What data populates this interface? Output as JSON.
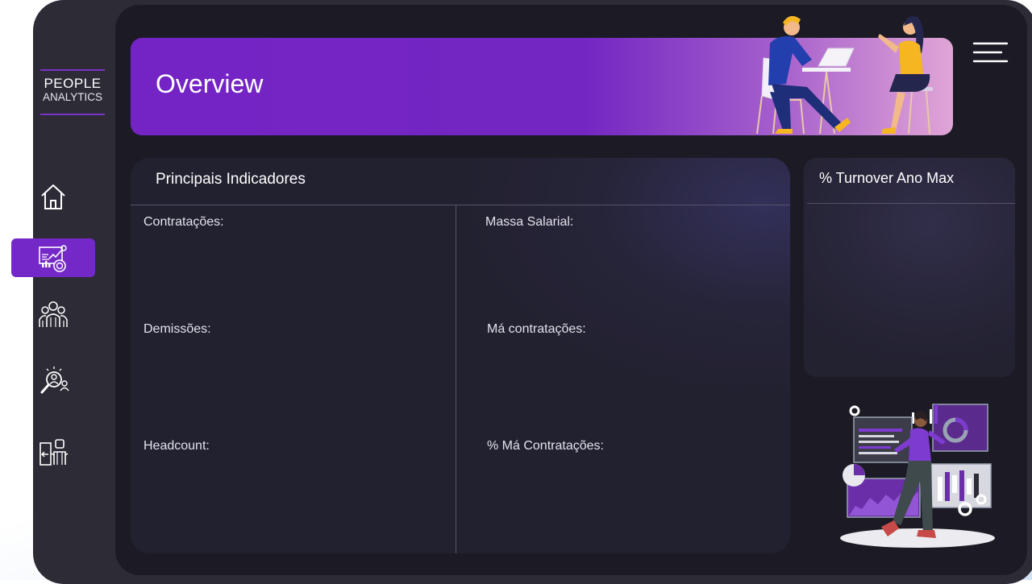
{
  "brand": {
    "line1": "PEOPLE",
    "line2": "ANALYTICS"
  },
  "sidebar": {
    "items": [
      {
        "icon": "home-icon",
        "active": false
      },
      {
        "icon": "analytics-dashboard-icon",
        "active": true
      },
      {
        "icon": "team-icon",
        "active": false
      },
      {
        "icon": "talent-search-icon",
        "active": false
      },
      {
        "icon": "employee-exit-icon",
        "active": false
      }
    ]
  },
  "header": {
    "title": "Overview",
    "menu_icon": "hamburger-menu-icon"
  },
  "indicators": {
    "title": "Principais Indicadores",
    "left": [
      {
        "label": "Contratações:"
      },
      {
        "label": "Demissões:"
      },
      {
        "label": "Headcount:"
      }
    ],
    "right": [
      {
        "label": "Massa Salarial:"
      },
      {
        "label": "Má contratações:"
      },
      {
        "label": "% Má Contratações:"
      }
    ]
  },
  "turnover": {
    "title": "% Turnover Ano Max"
  },
  "colors": {
    "accent": "#7428c8",
    "banner_start": "#7424c4",
    "banner_end": "#e0a5d6",
    "background": "#1c1b25",
    "frame": "#2c2b36"
  }
}
